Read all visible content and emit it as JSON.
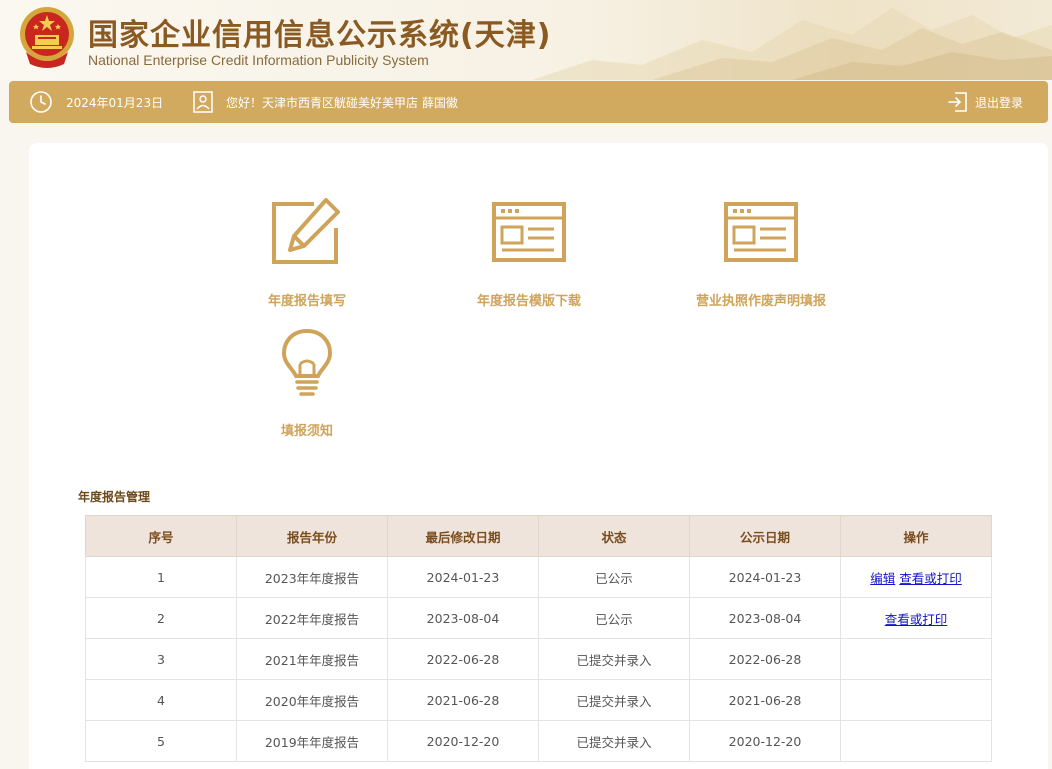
{
  "header": {
    "title": "国家企业信用信息公示系统(天津)",
    "subtitle": "National Enterprise Credit Information Publicity System"
  },
  "topbar": {
    "date": "2024年01月23日",
    "greeting": "您好！天津市西青区觥碰美好美甲店   薛国徽",
    "logout_label": "退出登录"
  },
  "tiles": [
    {
      "label": "年度报告填写",
      "icon": "pencil-edit-icon"
    },
    {
      "label": "年度报告模版下载",
      "icon": "browser-window-icon"
    },
    {
      "label": "营业执照作废声明填报",
      "icon": "browser-window-icon"
    },
    {
      "label": "填报须知",
      "icon": "lightbulb-icon"
    }
  ],
  "section_title": "年度报告管理",
  "table": {
    "columns": [
      "序号",
      "报告年份",
      "最后修改日期",
      "状态",
      "公示日期",
      "操作"
    ],
    "rows": [
      {
        "no": "1",
        "year": "2023年年度报告",
        "modified": "2024-01-23",
        "status": "已公示",
        "published": "2024-01-23",
        "actions": [
          "编辑",
          "查看或打印"
        ]
      },
      {
        "no": "2",
        "year": "2022年年度报告",
        "modified": "2023-08-04",
        "status": "已公示",
        "published": "2023-08-04",
        "actions": [
          "查看或打印"
        ]
      },
      {
        "no": "3",
        "year": "2021年年度报告",
        "modified": "2022-06-28",
        "status": "已提交并录入",
        "published": "2022-06-28",
        "actions": []
      },
      {
        "no": "4",
        "year": "2020年年度报告",
        "modified": "2021-06-28",
        "status": "已提交并录入",
        "published": "2021-06-28",
        "actions": []
      },
      {
        "no": "5",
        "year": "2019年年度报告",
        "modified": "2020-12-20",
        "status": "已提交并录入",
        "published": "2020-12-20",
        "actions": []
      }
    ]
  },
  "colors": {
    "accent": "#d2aa5f",
    "title": "#8a5a22",
    "tile_gold": "#cfa45a",
    "table_header_bg": "#eee4dc",
    "link": "#1414cc"
  }
}
